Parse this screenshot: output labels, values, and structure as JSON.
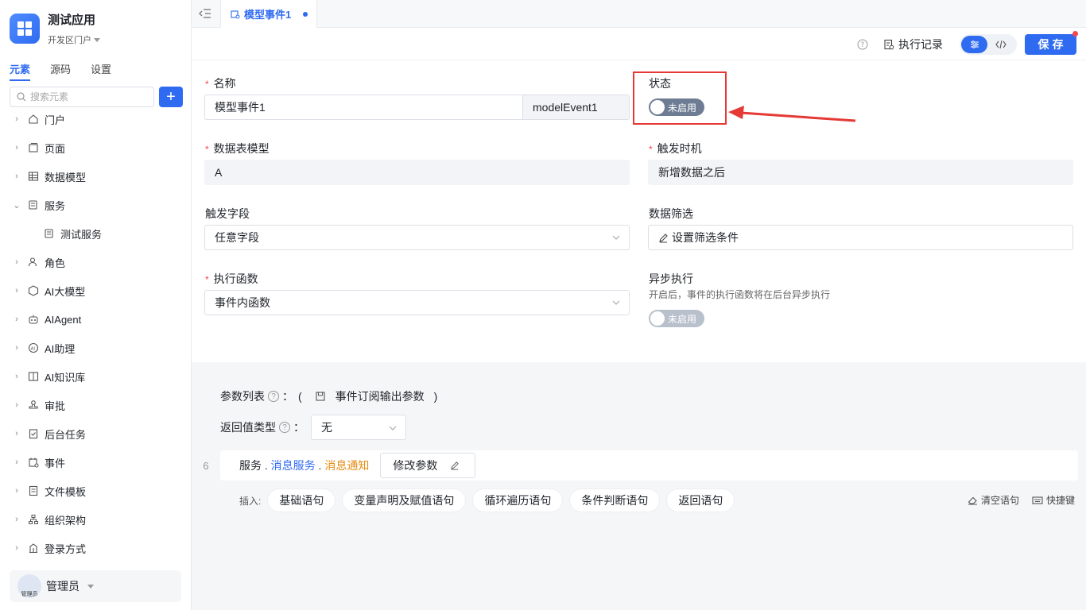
{
  "app": {
    "name": "测试应用",
    "portal": "开发区门户"
  },
  "sidebar": {
    "tabs": [
      {
        "label": "元素",
        "active": true
      },
      {
        "label": "源码",
        "active": false
      },
      {
        "label": "设置",
        "active": false
      }
    ],
    "search_placeholder": "搜索元素",
    "add_label": "+",
    "items": [
      {
        "label": "门户",
        "icon": "home-icon",
        "expanded": false
      },
      {
        "label": "页面",
        "icon": "page-icon",
        "expanded": false
      },
      {
        "label": "数据模型",
        "icon": "table-icon",
        "expanded": false
      },
      {
        "label": "服务",
        "icon": "service-icon",
        "expanded": true
      },
      {
        "label": "测试服务",
        "icon": "service-icon",
        "child": true
      },
      {
        "label": "角色",
        "icon": "role-icon",
        "expanded": false
      },
      {
        "label": "AI大模型",
        "icon": "ai-model-icon",
        "expanded": false
      },
      {
        "label": "AIAgent",
        "icon": "robot-icon",
        "expanded": false
      },
      {
        "label": "AI助理",
        "icon": "ai-assistant-icon",
        "expanded": false
      },
      {
        "label": "AI知识库",
        "icon": "book-icon",
        "expanded": false
      },
      {
        "label": "审批",
        "icon": "stamp-icon",
        "expanded": false
      },
      {
        "label": "后台任务",
        "icon": "task-icon",
        "expanded": false
      },
      {
        "label": "事件",
        "icon": "event-icon",
        "expanded": false
      },
      {
        "label": "文件模板",
        "icon": "file-template-icon",
        "expanded": false
      },
      {
        "label": "组织架构",
        "icon": "org-icon",
        "expanded": false
      },
      {
        "label": "登录方式",
        "icon": "login-icon",
        "expanded": false
      }
    ],
    "user": {
      "name": "管理员",
      "avatar_text": "管理员"
    }
  },
  "tabbar": {
    "tab_label": "模型事件1"
  },
  "toolbar": {
    "log_label": "执行记录",
    "save_label": "保存"
  },
  "form": {
    "name_label": "名称",
    "name_value": "模型事件1",
    "name_code": "modelEvent1",
    "status_label": "状态",
    "status_switch": "未启用",
    "table_label": "数据表模型",
    "table_value": "A",
    "trigger_time_label": "触发时机",
    "trigger_time_value": "新增数据之后",
    "trigger_field_label": "触发字段",
    "trigger_field_value": "任意字段",
    "filter_label": "数据筛选",
    "filter_value": "设置筛选条件",
    "func_label": "执行函数",
    "func_value": "事件内函数",
    "async_label": "异步执行",
    "async_hint": "开启后，事件的执行函数将在后台异步执行",
    "async_switch": "未启用"
  },
  "code": {
    "param_label": "参数列表",
    "colon": "：",
    "paren_open": "(",
    "param_value": "事件订阅输出参数",
    "paren_close": ")",
    "return_label": "返回值类型",
    "return_value": "无",
    "line_number": "6",
    "seg1": "服务",
    "dot1": " . ",
    "seg2": "消息服务",
    "dot2": " . ",
    "seg3": "消息通知",
    "modify_label": "修改参数",
    "insert_label": "插入:",
    "chips": [
      "基础语句",
      "变量声明及赋值语句",
      "循环遍历语句",
      "条件判断语句",
      "返回语句"
    ],
    "clear_label": "清空语句",
    "shortcut_label": "快捷键"
  },
  "colors": {
    "accent": "#2f6bf0",
    "highlight": "#e53935",
    "orange": "#e78b13"
  }
}
